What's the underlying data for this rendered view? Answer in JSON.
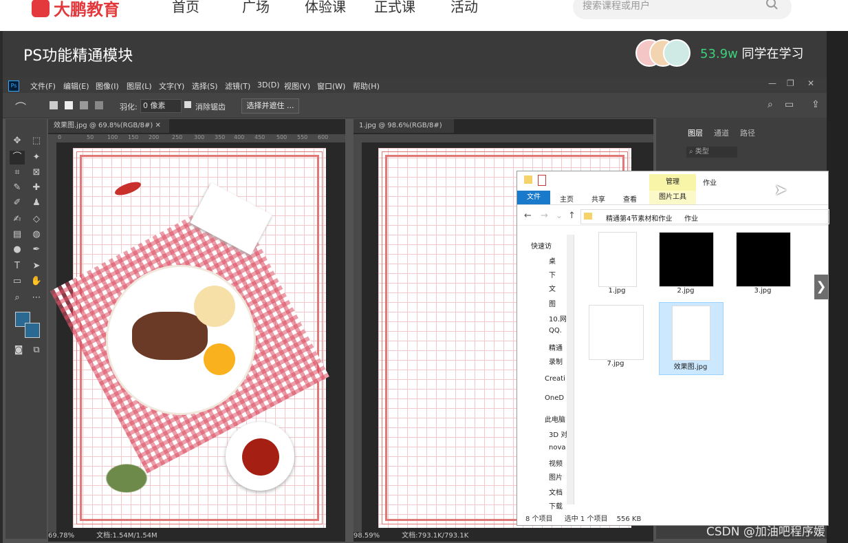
{
  "site": {
    "logo": "大鹏教育",
    "nav": [
      "首页",
      "广场",
      "体验课",
      "正式课",
      "活动"
    ],
    "search_placeholder": "搜索课程或用户"
  },
  "course": {
    "title": "PS功能精通模块",
    "learners_count": "53.9w",
    "learners_text": "同学在学习"
  },
  "ps": {
    "menu": [
      "文件(F)",
      "编辑(E)",
      "图像(I)",
      "图层(L)",
      "文字(Y)",
      "选择(S)",
      "滤镜(T)",
      "3D(D)",
      "视图(V)",
      "窗口(W)",
      "帮助(H)"
    ],
    "options": {
      "feather_label": "羽化:",
      "feather_value": "0 像素",
      "antialias_label": "消除锯齿",
      "select_mask": "选择并遮住 ..."
    },
    "docs": [
      {
        "tab": "效果图.jpg @ 69.8%(RGB/8#)",
        "zoom": "69.78%",
        "size": "文档:1.54M/1.54M"
      },
      {
        "tab": "1.jpg @ 98.6%(RGB/8#)",
        "zoom": "98.59%",
        "size": "文档:793.1K/793.1K"
      }
    ],
    "ruler_ticks": [
      "0",
      "50",
      "100",
      "150",
      "200",
      "250",
      "300",
      "350",
      "400",
      "450",
      "500",
      "550",
      "600"
    ],
    "panel_tabs": [
      "图层",
      "通道",
      "路径"
    ],
    "panel_filter": "类型"
  },
  "explorer": {
    "ribbon_tabs": [
      "文件",
      "主页",
      "共享",
      "查看"
    ],
    "manage_tab": "管理",
    "picture_tools": "图片工具",
    "title": "作业",
    "breadcrumb": [
      "精通第4节素材和作业",
      "作业"
    ],
    "sidebar": [
      "快速访",
      "桌",
      "下",
      "文",
      "图",
      "10.网",
      "QQ.",
      "精通",
      "录制",
      "Creati",
      "OneD",
      "此电脑",
      "3D 对",
      "nova",
      "视频",
      "图片",
      "文档",
      "下载"
    ],
    "files": [
      "1.jpg",
      "2.jpg",
      "3.jpg",
      "7.jpg",
      "效果图.jpg"
    ],
    "status_items": "8 个项目",
    "status_selected": "选中 1 个项目",
    "status_size": "556 KB"
  },
  "watermark": "CSDN @加油吧程序媛",
  "colors": {
    "brand": "#e4393c",
    "learners": "#3cd27a",
    "explorer_selected": "#cce8ff",
    "canvas_border": "#e07878"
  }
}
